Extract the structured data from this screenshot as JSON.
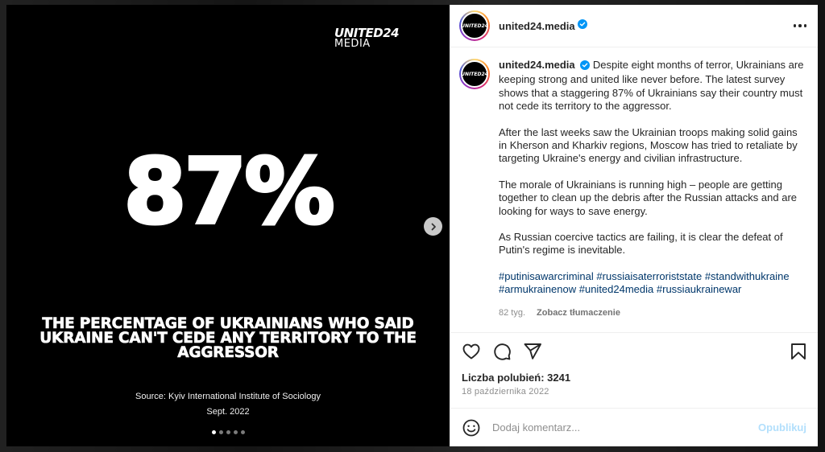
{
  "post": {
    "brand_top": "UNITED24",
    "brand_bottom": "MEDIA",
    "big_number": "87%",
    "headline": "THE PERCENTAGE OF UKRAINIANS WHO SAID UKRAINE CAN'T CEDE ANY TERRITORY TO THE AGGRESSOR",
    "source_line1": "Source: Kyiv International Institute of Sociology",
    "source_line2": "Sept. 2022",
    "slide_count": 5,
    "active_slide": 1
  },
  "header": {
    "avatar_text": "UNITED24",
    "username": "united24.media"
  },
  "caption": {
    "username": "united24.media",
    "paragraph1": "Despite eight months of terror, Ukrainians are keeping strong and united like never before. The latest survey shows that a staggering 87% of Ukrainians say their country must not cede its territory to the aggressor.",
    "paragraph2": "After the last weeks saw the Ukrainian troops making solid gains in Kherson and Kharkiv regions, Moscow has tried to retaliate by targeting Ukraine's energy and civilian infrastructure.",
    "paragraph3": "The morale of Ukrainians is running high – people are getting together to clean up the debris after the Russian attacks and are looking for ways to save energy.",
    "paragraph4": "As Russian coercive tactics are failing, it is clear the defeat of Putin's regime is inevitable.",
    "hashtags": [
      "#putinisawarcriminal",
      "#russiaisaterroriststate",
      "#standwithukraine",
      "#armukrainenow",
      "#united24media",
      "#russiaukrainewar"
    ],
    "age": "82 tyg.",
    "translate": "Zobacz tłumaczenie"
  },
  "engagement": {
    "likes": "Liczba polubień: 3241",
    "date": "18 października 2022"
  },
  "comment": {
    "placeholder": "Dodaj komentarz...",
    "publish": "Opublikuj"
  },
  "colors": {
    "verified": "#0095f6",
    "link": "#00376b",
    "publish_disabled": "#b2dffc"
  }
}
